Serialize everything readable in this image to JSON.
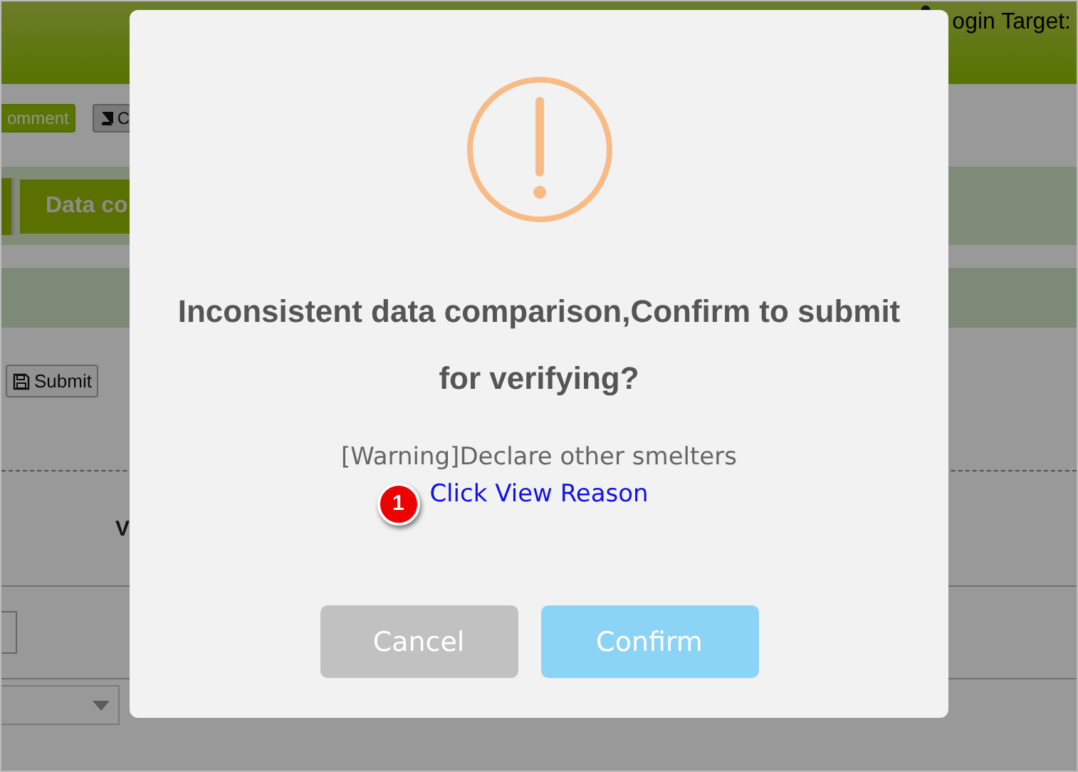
{
  "header": {
    "login_label": "ogin Target:"
  },
  "toolbar": [
    {
      "label": "omment",
      "kind": "comment"
    },
    {
      "label": "C",
      "kind": "book"
    }
  ],
  "tab": {
    "label": "Data co"
  },
  "submit_button": {
    "label": "Submit"
  },
  "form_label": "V",
  "dialog": {
    "title": "Inconsistent data comparison,Confirm to submit for verifying?",
    "message": "[Warning]Declare other smelters",
    "link": "Click View Reason",
    "marker": "1",
    "buttons": [
      {
        "label": "Cancel",
        "kind": "cancel"
      },
      {
        "label": "Confirm",
        "kind": "confirm"
      }
    ]
  }
}
